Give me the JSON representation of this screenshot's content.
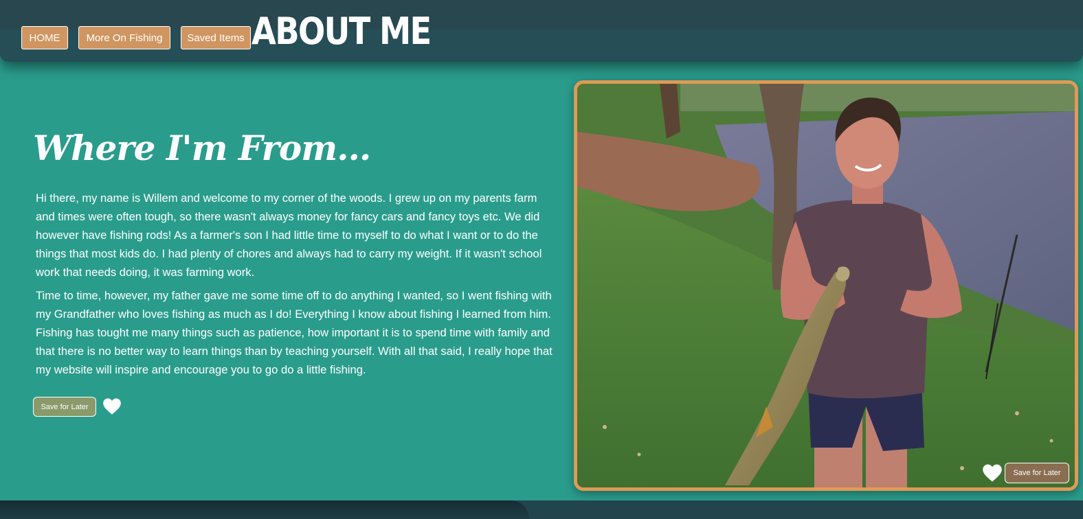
{
  "nav": {
    "home": "HOME",
    "more_on_fishing": "More On Fishing",
    "saved_items": "Saved Items"
  },
  "page_title": "ABOUT ME",
  "section": {
    "heading": "Where I'm From...",
    "paragraph1": "Hi there, my name is Willem and welcome to my corner of the woods. I grew up on my parents farm and times were often tough, so there wasn't always money for fancy cars and fancy toys etc. We did however have fishing rods! As a farmer's son I had little time to myself to do what I want or to do the things that most kids do. I had plenty of chores and always had to carry my weight. If it wasn't school work that needs doing, it was farming work.",
    "paragraph2": "Time to time, however, my father gave me some time off to do anything I wanted, so I went fishing with my Grandfather who loves fishing as much as I do! Everything I know about fishing I learned from him. Fishing has tought me many things such as patience, how important it is to spend time with family and that there is no better way to learn things than by teaching yourself. With all that said, I really hope that my website will inspire and encourage you to go do a little fishing.",
    "save_label": "Save for Later"
  },
  "photo": {
    "save_label": "Save for Later"
  },
  "colors": {
    "background": "#2a9c8c",
    "header": "#254e57",
    "nav_button": "#d09560",
    "photo_border": "#e09a55"
  },
  "icons": {
    "like": "heart-icon"
  }
}
